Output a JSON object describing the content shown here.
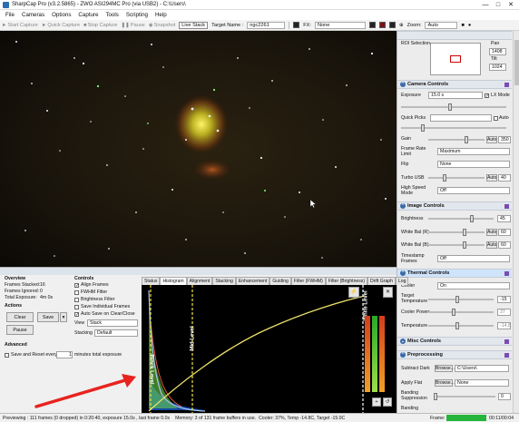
{
  "window": {
    "title": "SharpCap Pro (v3.2.5865) - ZWO ASI294MC Pro (via USB2) - C:\\Users\\"
  },
  "menu": [
    "File",
    "Cameras",
    "Options",
    "Capture",
    "Tools",
    "Scripting",
    "Help"
  ],
  "toolbar": {
    "start_capture": "Start Capture",
    "quick_capture": "Quick Capture",
    "stop_capture": "Stop Capture",
    "pause": "Pause",
    "snapshot": "Snapshot",
    "live_stack": "Live Stack",
    "target_label": "Target Name :",
    "target_value": "ngc2261",
    "fx_label": "FX:",
    "fx_value": "None",
    "zoom_label": "Zoom:",
    "zoom_value": "Auto"
  },
  "right_panel": {
    "roi_label": "ROI Selection",
    "pan_label": "Pan",
    "pan_value": "1408",
    "tilt_label": "Tilt",
    "tilt_value": "1024",
    "camera_controls": {
      "header": "Camera Controls",
      "exposure_label": "Exposure",
      "exposure_value": "15.0 s",
      "lx_mode": "LX Mode",
      "quick_picks_label": "Quick Picks",
      "auto": "Auto",
      "gain_label": "Gain",
      "gain_value": "350",
      "frame_rate_label": "Frame Rate Limit",
      "frame_rate_value": "Maximum",
      "flip_label": "Flip",
      "flip_value": "None",
      "turbo_label": "Turbo USB",
      "turbo_value": "40",
      "hsm_label": "High Speed Mode",
      "hsm_value": "Off"
    },
    "image_controls": {
      "header": "Image Controls",
      "brightness_label": "Brightness",
      "brightness_value": "45",
      "wb_r_label": "White Bal (R)",
      "wb_r_value": "60",
      "wb_b_label": "White Bal (B)",
      "wb_b_value": "60",
      "timestamp_label": "Timestamp Frames",
      "timestamp_value": "Off"
    },
    "thermal_controls": {
      "header": "Thermal Controls",
      "cooler_label": "Cooler",
      "cooler_value": "On",
      "target_temp_label": "Target Temperature",
      "target_temp_value": "-15",
      "cooler_power_label": "Cooler Power",
      "cooler_power_value": "37",
      "temperature_label": "Temperature",
      "temperature_value": "-14.8"
    },
    "misc_controls": {
      "header": "Misc Controls"
    },
    "preprocessing": {
      "header": "Preprocessing",
      "subtract_dark_label": "Subtract Dark",
      "browse": "Browse...",
      "subtract_dark_value": "C:\\Users\\",
      "apply_flat_label": "Apply Flat",
      "apply_flat_value": "None",
      "banding_label": "Banding Suppression",
      "banding_value": "0",
      "banding_2_label": "Banding"
    }
  },
  "stack_panel": {
    "overview": "Overview",
    "frames_stacked_label": "Frames Stacked:",
    "frames_stacked_value": "16",
    "frames_ignored_label": "Frames Ignored:",
    "frames_ignored_value": "0",
    "total_exposure_label": "Total Exposure:",
    "total_exposure_value": "4m 0s",
    "actions": "Actions",
    "clear": "Clear",
    "save": "Save",
    "pause": "Pause",
    "advanced": "Advanced",
    "save_reset_label": "Save and Reset every",
    "save_reset_value": "1",
    "minutes_label": "minutes total exposure",
    "controls": "Controls",
    "align_frames": "Align Frames",
    "fwhm_filter": "FWHM Filter",
    "brightness_filter": "Brightness Filter",
    "save_individual": "Save Individual Frames",
    "auto_save": "Auto Save on Clear/Close",
    "view_label": "View",
    "view_value": "Stack",
    "stacking_label": "Stacking",
    "stacking_value": "Default"
  },
  "tabs": [
    "Status",
    "Histogram",
    "Alignment",
    "Stacking",
    "Enhancement",
    "Guiding",
    "Filter (FWHM)",
    "Filter (Brightness)",
    "Drift Graph",
    "Log"
  ],
  "histogram": {
    "black_level": "Black Level",
    "mid_level": "Mid Level",
    "white_level": "White Level",
    "buttons": [
      "⚡",
      "✕",
      "+",
      "↺"
    ]
  },
  "status": {
    "text": "Previewing : 111 frames (0 dropped) in 0:20:40, exposure 15.0s , last frame 0.0s",
    "memory": "Memory: 3 of 131 frame buffers in use.",
    "cooler": "Cooler: 37%, Temp -14.8C, Target -15.0C",
    "frame_label": "Frame:",
    "frame_time": "00:11/00:04"
  },
  "colors": {
    "accent": "#3b6aa8",
    "menu_accent": "#7a4bb0",
    "annotation_arrow": "#e8231f",
    "frame_progress": "#25b53a",
    "black_level_line": "#f2e14a",
    "white_level_line": "#ffffff"
  }
}
